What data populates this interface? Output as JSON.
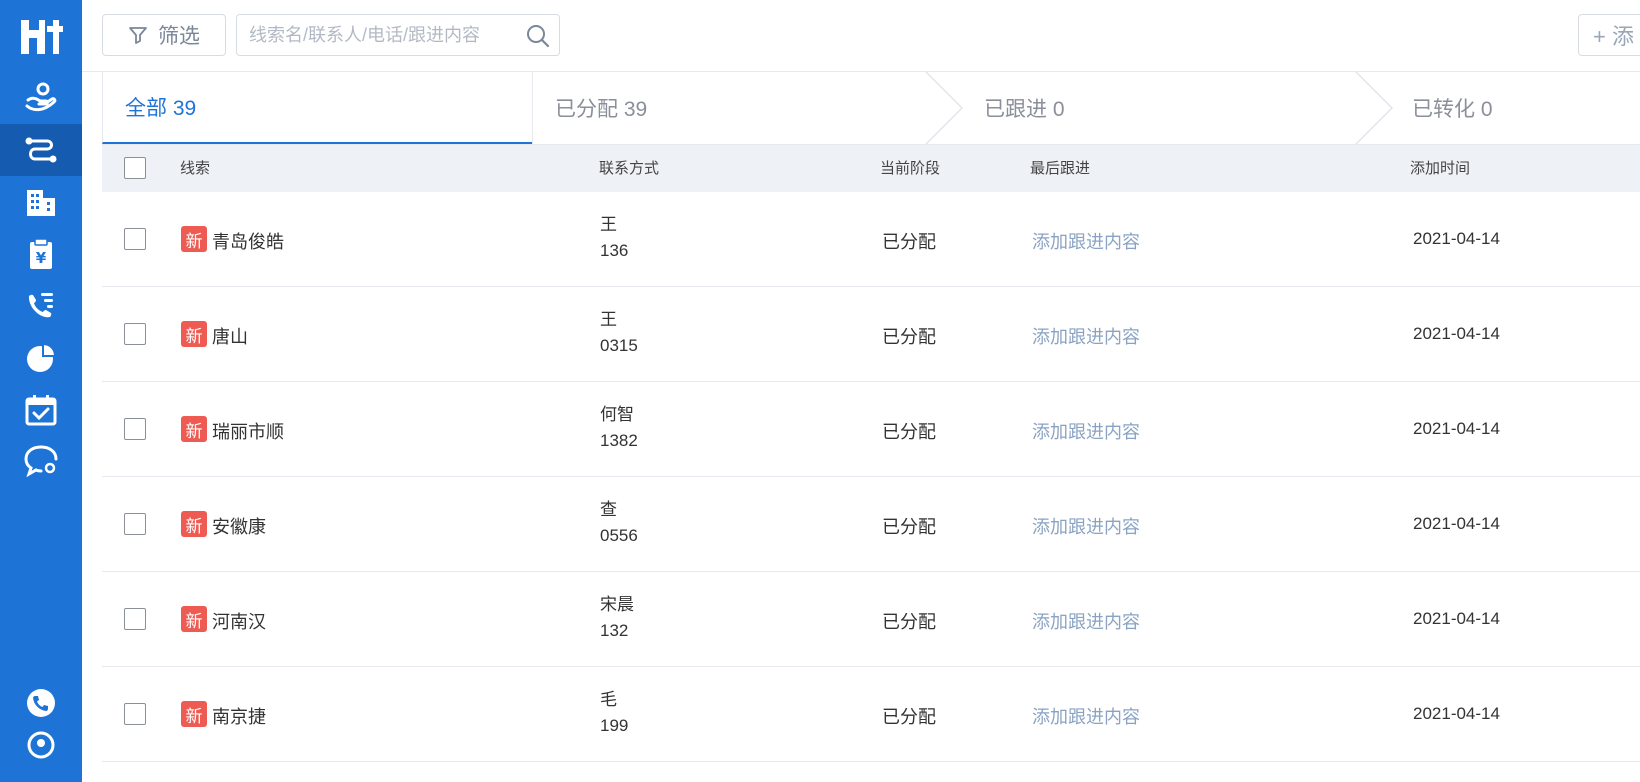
{
  "sidebar": {
    "logo": "crm-logo",
    "items": [
      {
        "icon": "customer-hand-icon",
        "active": false
      },
      {
        "icon": "leads-path-icon",
        "active": true
      },
      {
        "icon": "company-building-icon",
        "active": false
      },
      {
        "icon": "contract-yen-icon",
        "active": false
      },
      {
        "icon": "phone-list-icon",
        "active": false
      },
      {
        "icon": "report-pie-icon",
        "active": false
      },
      {
        "icon": "calendar-check-icon",
        "active": false
      },
      {
        "icon": "chat-bubble-icon",
        "active": false
      }
    ],
    "bottom": [
      {
        "icon": "phone-icon"
      },
      {
        "icon": "user-icon"
      }
    ]
  },
  "toolbar": {
    "filter_label": "筛选",
    "search_placeholder": "线索名/联系人/电话/跟进内容",
    "add_label": "+ 添"
  },
  "stages": [
    {
      "label": "全部 39",
      "active": true
    },
    {
      "label": "已分配 39",
      "active": false
    },
    {
      "label": "已跟进 0",
      "active": false
    },
    {
      "label": "已转化 0",
      "active": false
    }
  ],
  "table": {
    "columns": [
      "线索",
      "联系方式",
      "当前阶段",
      "最后跟进",
      "添加时间"
    ],
    "rows": [
      {
        "badge": "新",
        "name": "青岛俊皓",
        "contact_name": "王",
        "phone": "136",
        "stage": "已分配",
        "follow": "添加跟进内容",
        "date": "2021-04-14"
      },
      {
        "badge": "新",
        "name": "唐山",
        "contact_name": "王",
        "phone": "0315",
        "stage": "已分配",
        "follow": "添加跟进内容",
        "date": "2021-04-14"
      },
      {
        "badge": "新",
        "name": "瑞丽市顺",
        "contact_name": "何智",
        "phone": "1382",
        "stage": "已分配",
        "follow": "添加跟进内容",
        "date": "2021-04-14"
      },
      {
        "badge": "新",
        "name": "安徽康",
        "contact_name": "查",
        "phone": "0556",
        "stage": "已分配",
        "follow": "添加跟进内容",
        "date": "2021-04-14"
      },
      {
        "badge": "新",
        "name": "河南汉",
        "contact_name": "宋晨",
        "phone": "132",
        "stage": "已分配",
        "follow": "添加跟进内容",
        "date": "2021-04-14"
      },
      {
        "badge": "新",
        "name": "南京捷",
        "contact_name": "毛",
        "phone": "199",
        "stage": "已分配",
        "follow": "添加跟进内容",
        "date": "2021-04-14"
      }
    ]
  },
  "colors": {
    "sidebar": "#1e74d6",
    "sidebar_active": "#155bb0",
    "badge": "#ee5b52",
    "link": "#8aa3c3",
    "accent": "#1e74d6"
  }
}
